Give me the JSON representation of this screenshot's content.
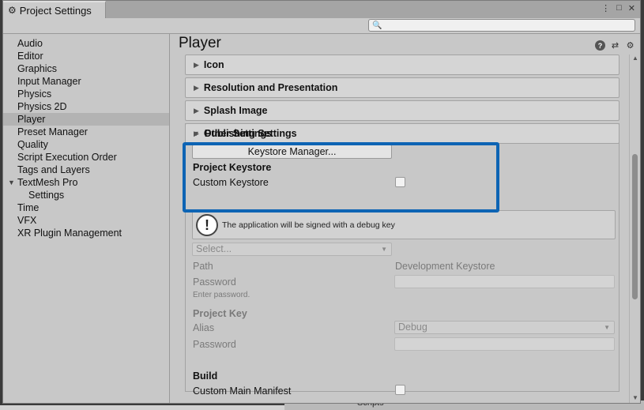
{
  "window": {
    "tab_title": "Project Settings",
    "tab_icon": "gear-icon",
    "controls": [
      "⋮",
      "□",
      "✕"
    ]
  },
  "search": {
    "placeholder": ""
  },
  "sidebar": {
    "items": [
      {
        "label": "Audio"
      },
      {
        "label": "Editor"
      },
      {
        "label": "Graphics"
      },
      {
        "label": "Input Manager"
      },
      {
        "label": "Physics"
      },
      {
        "label": "Physics 2D"
      },
      {
        "label": "Player",
        "active": true
      },
      {
        "label": "Preset Manager"
      },
      {
        "label": "Quality"
      },
      {
        "label": "Script Execution Order"
      },
      {
        "label": "Tags and Layers"
      },
      {
        "label": "TextMesh Pro",
        "expanded": true
      },
      {
        "label": "Settings",
        "child": true
      },
      {
        "label": "Time"
      },
      {
        "label": "VFX"
      },
      {
        "label": "XR Plugin Management"
      }
    ]
  },
  "main": {
    "title": "Player",
    "header_icons": [
      "help-icon",
      "preset-icon",
      "gear-icon"
    ],
    "sections": [
      {
        "label": "Icon"
      },
      {
        "label": "Resolution and Presentation"
      },
      {
        "label": "Splash Image"
      },
      {
        "label": "Other Settings"
      }
    ],
    "publishing": {
      "label": "Publishing Settings",
      "keystore_manager_button": "Keystore Manager...",
      "project_keystore_heading": "Project Keystore",
      "custom_keystore_label": "Custom Keystore",
      "custom_keystore_checked": false,
      "info_message": "The application will be signed with a debug key",
      "select_placeholder": "Select...",
      "path_label": "Path",
      "path_value": "Development Keystore",
      "password_label": "Password",
      "password_hint": "Enter password.",
      "project_key_heading": "Project Key",
      "alias_label": "Alias",
      "alias_value": "Debug",
      "key_password_label": "Password",
      "build_heading": "Build",
      "custom_main_manifest_label": "Custom Main Manifest",
      "custom_main_manifest_checked": false
    }
  },
  "background": {
    "label": "Scripts"
  },
  "colors": {
    "highlight": "#0d64b4"
  }
}
